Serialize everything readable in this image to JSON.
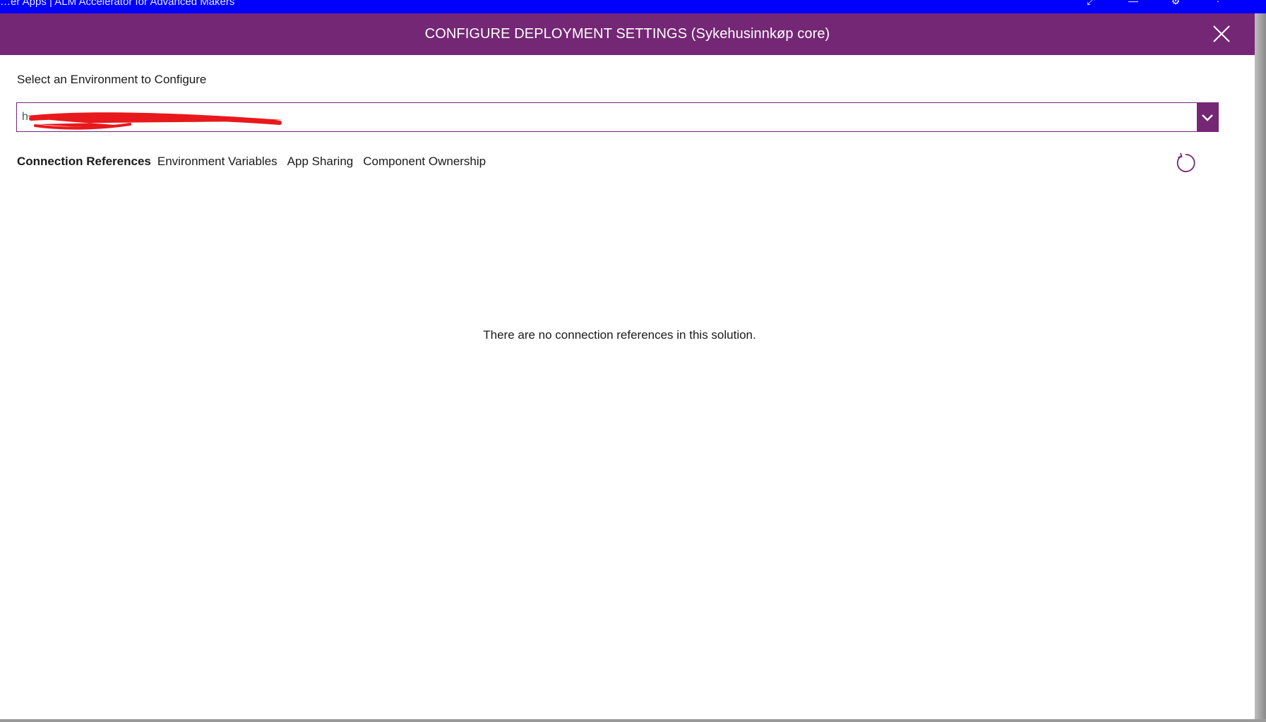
{
  "window": {
    "title": "…er Apps | ALM Accelerator for Advanced Makers",
    "controls": [
      "⤢",
      "—",
      "⚙",
      "·"
    ]
  },
  "dialog": {
    "title": "CONFIGURE DEPLOYMENT SETTINGS (Sykehusinnkøp core)",
    "close_icon": "close-icon",
    "header_color": "#742774"
  },
  "environment": {
    "label": "Select an Environment to Configure",
    "selected_value": "h",
    "dropdown_icon": "chevron-down-icon"
  },
  "tabs": [
    {
      "label": "Connection References",
      "active": true
    },
    {
      "label": "Environment Variables",
      "active": false
    },
    {
      "label": "App Sharing",
      "active": false
    },
    {
      "label": "Component Ownership",
      "active": false
    }
  ],
  "refresh_icon": "refresh-icon",
  "empty_message": "There are no connection references in this solution.",
  "colors": {
    "accent": "#742774",
    "titlebar": "#0000ff",
    "redaction": "#e8191c"
  }
}
